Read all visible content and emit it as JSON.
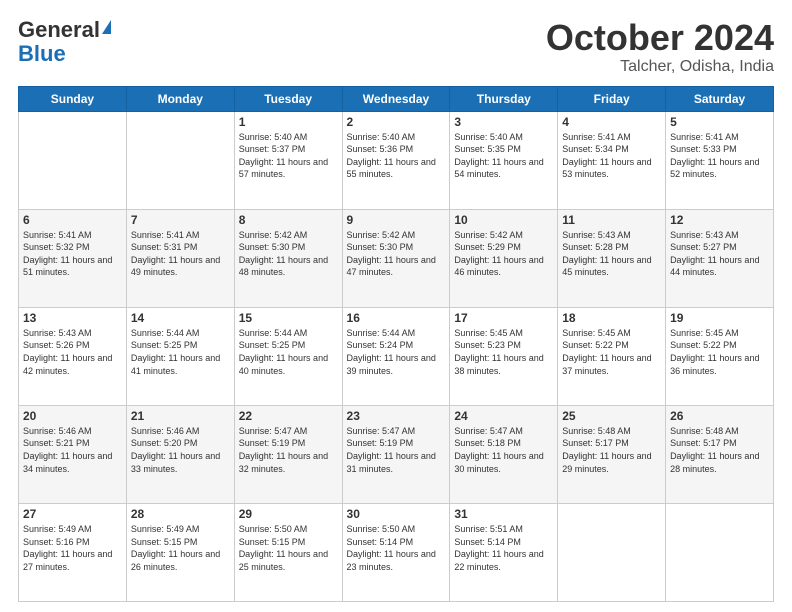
{
  "logo": {
    "line1": "General",
    "line2": "Blue"
  },
  "title": "October 2024",
  "subtitle": "Talcher, Odisha, India",
  "days_of_week": [
    "Sunday",
    "Monday",
    "Tuesday",
    "Wednesday",
    "Thursday",
    "Friday",
    "Saturday"
  ],
  "weeks": [
    [
      {
        "day": "",
        "sunrise": "",
        "sunset": "",
        "daylight": ""
      },
      {
        "day": "",
        "sunrise": "",
        "sunset": "",
        "daylight": ""
      },
      {
        "day": "1",
        "sunrise": "Sunrise: 5:40 AM",
        "sunset": "Sunset: 5:37 PM",
        "daylight": "Daylight: 11 hours and 57 minutes."
      },
      {
        "day": "2",
        "sunrise": "Sunrise: 5:40 AM",
        "sunset": "Sunset: 5:36 PM",
        "daylight": "Daylight: 11 hours and 55 minutes."
      },
      {
        "day": "3",
        "sunrise": "Sunrise: 5:40 AM",
        "sunset": "Sunset: 5:35 PM",
        "daylight": "Daylight: 11 hours and 54 minutes."
      },
      {
        "day": "4",
        "sunrise": "Sunrise: 5:41 AM",
        "sunset": "Sunset: 5:34 PM",
        "daylight": "Daylight: 11 hours and 53 minutes."
      },
      {
        "day": "5",
        "sunrise": "Sunrise: 5:41 AM",
        "sunset": "Sunset: 5:33 PM",
        "daylight": "Daylight: 11 hours and 52 minutes."
      }
    ],
    [
      {
        "day": "6",
        "sunrise": "Sunrise: 5:41 AM",
        "sunset": "Sunset: 5:32 PM",
        "daylight": "Daylight: 11 hours and 51 minutes."
      },
      {
        "day": "7",
        "sunrise": "Sunrise: 5:41 AM",
        "sunset": "Sunset: 5:31 PM",
        "daylight": "Daylight: 11 hours and 49 minutes."
      },
      {
        "day": "8",
        "sunrise": "Sunrise: 5:42 AM",
        "sunset": "Sunset: 5:30 PM",
        "daylight": "Daylight: 11 hours and 48 minutes."
      },
      {
        "day": "9",
        "sunrise": "Sunrise: 5:42 AM",
        "sunset": "Sunset: 5:30 PM",
        "daylight": "Daylight: 11 hours and 47 minutes."
      },
      {
        "day": "10",
        "sunrise": "Sunrise: 5:42 AM",
        "sunset": "Sunset: 5:29 PM",
        "daylight": "Daylight: 11 hours and 46 minutes."
      },
      {
        "day": "11",
        "sunrise": "Sunrise: 5:43 AM",
        "sunset": "Sunset: 5:28 PM",
        "daylight": "Daylight: 11 hours and 45 minutes."
      },
      {
        "day": "12",
        "sunrise": "Sunrise: 5:43 AM",
        "sunset": "Sunset: 5:27 PM",
        "daylight": "Daylight: 11 hours and 44 minutes."
      }
    ],
    [
      {
        "day": "13",
        "sunrise": "Sunrise: 5:43 AM",
        "sunset": "Sunset: 5:26 PM",
        "daylight": "Daylight: 11 hours and 42 minutes."
      },
      {
        "day": "14",
        "sunrise": "Sunrise: 5:44 AM",
        "sunset": "Sunset: 5:25 PM",
        "daylight": "Daylight: 11 hours and 41 minutes."
      },
      {
        "day": "15",
        "sunrise": "Sunrise: 5:44 AM",
        "sunset": "Sunset: 5:25 PM",
        "daylight": "Daylight: 11 hours and 40 minutes."
      },
      {
        "day": "16",
        "sunrise": "Sunrise: 5:44 AM",
        "sunset": "Sunset: 5:24 PM",
        "daylight": "Daylight: 11 hours and 39 minutes."
      },
      {
        "day": "17",
        "sunrise": "Sunrise: 5:45 AM",
        "sunset": "Sunset: 5:23 PM",
        "daylight": "Daylight: 11 hours and 38 minutes."
      },
      {
        "day": "18",
        "sunrise": "Sunrise: 5:45 AM",
        "sunset": "Sunset: 5:22 PM",
        "daylight": "Daylight: 11 hours and 37 minutes."
      },
      {
        "day": "19",
        "sunrise": "Sunrise: 5:45 AM",
        "sunset": "Sunset: 5:22 PM",
        "daylight": "Daylight: 11 hours and 36 minutes."
      }
    ],
    [
      {
        "day": "20",
        "sunrise": "Sunrise: 5:46 AM",
        "sunset": "Sunset: 5:21 PM",
        "daylight": "Daylight: 11 hours and 34 minutes."
      },
      {
        "day": "21",
        "sunrise": "Sunrise: 5:46 AM",
        "sunset": "Sunset: 5:20 PM",
        "daylight": "Daylight: 11 hours and 33 minutes."
      },
      {
        "day": "22",
        "sunrise": "Sunrise: 5:47 AM",
        "sunset": "Sunset: 5:19 PM",
        "daylight": "Daylight: 11 hours and 32 minutes."
      },
      {
        "day": "23",
        "sunrise": "Sunrise: 5:47 AM",
        "sunset": "Sunset: 5:19 PM",
        "daylight": "Daylight: 11 hours and 31 minutes."
      },
      {
        "day": "24",
        "sunrise": "Sunrise: 5:47 AM",
        "sunset": "Sunset: 5:18 PM",
        "daylight": "Daylight: 11 hours and 30 minutes."
      },
      {
        "day": "25",
        "sunrise": "Sunrise: 5:48 AM",
        "sunset": "Sunset: 5:17 PM",
        "daylight": "Daylight: 11 hours and 29 minutes."
      },
      {
        "day": "26",
        "sunrise": "Sunrise: 5:48 AM",
        "sunset": "Sunset: 5:17 PM",
        "daylight": "Daylight: 11 hours and 28 minutes."
      }
    ],
    [
      {
        "day": "27",
        "sunrise": "Sunrise: 5:49 AM",
        "sunset": "Sunset: 5:16 PM",
        "daylight": "Daylight: 11 hours and 27 minutes."
      },
      {
        "day": "28",
        "sunrise": "Sunrise: 5:49 AM",
        "sunset": "Sunset: 5:15 PM",
        "daylight": "Daylight: 11 hours and 26 minutes."
      },
      {
        "day": "29",
        "sunrise": "Sunrise: 5:50 AM",
        "sunset": "Sunset: 5:15 PM",
        "daylight": "Daylight: 11 hours and 25 minutes."
      },
      {
        "day": "30",
        "sunrise": "Sunrise: 5:50 AM",
        "sunset": "Sunset: 5:14 PM",
        "daylight": "Daylight: 11 hours and 23 minutes."
      },
      {
        "day": "31",
        "sunrise": "Sunrise: 5:51 AM",
        "sunset": "Sunset: 5:14 PM",
        "daylight": "Daylight: 11 hours and 22 minutes."
      },
      {
        "day": "",
        "sunrise": "",
        "sunset": "",
        "daylight": ""
      },
      {
        "day": "",
        "sunrise": "",
        "sunset": "",
        "daylight": ""
      }
    ]
  ]
}
